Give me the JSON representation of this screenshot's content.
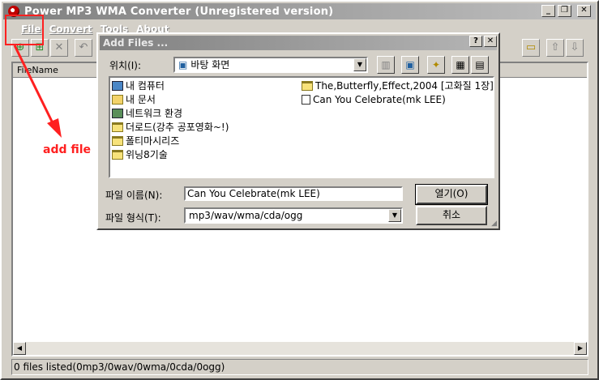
{
  "window": {
    "title": "Power MP3 WMA Converter (Unregistered version)"
  },
  "menu": [
    "File",
    "Convert",
    "Tools",
    "About"
  ],
  "list": {
    "column_filename": "FileName"
  },
  "status": "0 files listed(0mp3/0wav/0wma/0cda/0ogg)",
  "dialog": {
    "title": "Add Files ...",
    "location_label": "위치(I):",
    "location_value": "바탕 화면",
    "items_left": [
      "내 컴퓨터",
      "내 문서",
      "네트워크 환경",
      "더로드(강추 공포영화~!)",
      "폴티마시리즈",
      "위닝8기술"
    ],
    "items_right": [
      "The,Butterfly,Effect,2004 [고화질 1장]",
      "Can You Celebrate(mk LEE)"
    ],
    "filename_label": "파일 이름(N):",
    "filename_value": "Can You Celebrate(mk LEE)",
    "filetype_label": "파일 형식(T):",
    "filetype_value": "mp3/wav/wma/cda/ogg",
    "open_button": "열기(O)",
    "cancel_button": "취소",
    "help_glyph": "?",
    "close_glyph": "✕"
  },
  "annotation": {
    "text": "add file",
    "color": "#ff2020"
  }
}
